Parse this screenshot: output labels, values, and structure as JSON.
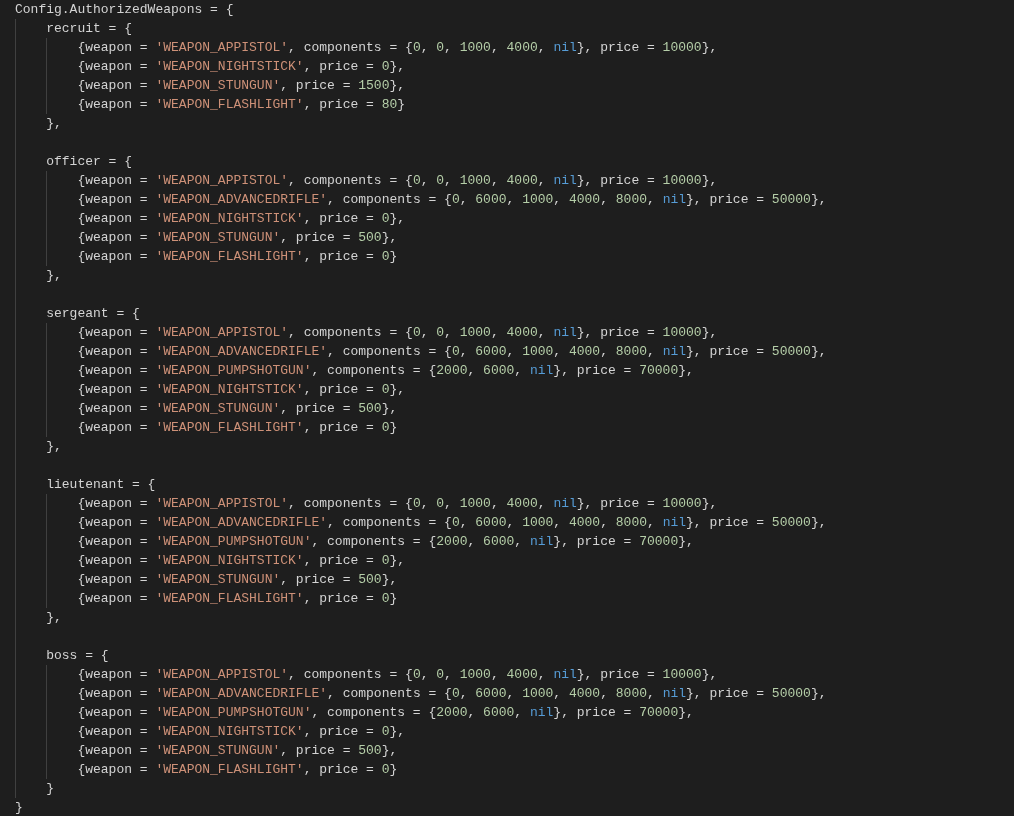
{
  "editor": {
    "code": [
      {
        "kind": "line",
        "tokens": [
          {
            "kind": "plain",
            "text": "Config.AuthorizedWeapons = {"
          }
        ],
        "children": [
          {
            "kind": "line",
            "tokens": [
              {
                "kind": "plain",
                "text": "recruit = {"
              }
            ],
            "children": [
              {
                "kind": "line",
                "tokens": [
                  {
                    "kind": "plain",
                    "text": "{weapon = "
                  },
                  {
                    "kind": "string",
                    "text": "'WEAPON_APPISTOL'"
                  },
                  {
                    "kind": "plain",
                    "text": ", components = {"
                  },
                  {
                    "kind": "number",
                    "text": "0"
                  },
                  {
                    "kind": "plain",
                    "text": ", "
                  },
                  {
                    "kind": "number",
                    "text": "0"
                  },
                  {
                    "kind": "plain",
                    "text": ", "
                  },
                  {
                    "kind": "number",
                    "text": "1000"
                  },
                  {
                    "kind": "plain",
                    "text": ", "
                  },
                  {
                    "kind": "number",
                    "text": "4000"
                  },
                  {
                    "kind": "plain",
                    "text": ", "
                  },
                  {
                    "kind": "keyword",
                    "text": "nil"
                  },
                  {
                    "kind": "plain",
                    "text": "}, price = "
                  },
                  {
                    "kind": "number",
                    "text": "10000"
                  },
                  {
                    "kind": "plain",
                    "text": "},"
                  }
                ]
              },
              {
                "kind": "line",
                "tokens": [
                  {
                    "kind": "plain",
                    "text": "{weapon = "
                  },
                  {
                    "kind": "string",
                    "text": "'WEAPON_NIGHTSTICK'"
                  },
                  {
                    "kind": "plain",
                    "text": ", price = "
                  },
                  {
                    "kind": "number",
                    "text": "0"
                  },
                  {
                    "kind": "plain",
                    "text": "},"
                  }
                ]
              },
              {
                "kind": "line",
                "tokens": [
                  {
                    "kind": "plain",
                    "text": "{weapon = "
                  },
                  {
                    "kind": "string",
                    "text": "'WEAPON_STUNGUN'"
                  },
                  {
                    "kind": "plain",
                    "text": ", price = "
                  },
                  {
                    "kind": "number",
                    "text": "1500"
                  },
                  {
                    "kind": "plain",
                    "text": "},"
                  }
                ]
              },
              {
                "kind": "line",
                "tokens": [
                  {
                    "kind": "plain",
                    "text": "{weapon = "
                  },
                  {
                    "kind": "string",
                    "text": "'WEAPON_FLASHLIGHT'"
                  },
                  {
                    "kind": "plain",
                    "text": ", price = "
                  },
                  {
                    "kind": "number",
                    "text": "80"
                  },
                  {
                    "kind": "plain",
                    "text": "}"
                  }
                ]
              }
            ]
          },
          {
            "kind": "line",
            "tokens": [
              {
                "kind": "plain",
                "text": "},"
              }
            ]
          },
          {
            "kind": "blank"
          },
          {
            "kind": "line",
            "tokens": [
              {
                "kind": "plain",
                "text": "officer = {"
              }
            ],
            "children": [
              {
                "kind": "line",
                "tokens": [
                  {
                    "kind": "plain",
                    "text": "{weapon = "
                  },
                  {
                    "kind": "string",
                    "text": "'WEAPON_APPISTOL'"
                  },
                  {
                    "kind": "plain",
                    "text": ", components = {"
                  },
                  {
                    "kind": "number",
                    "text": "0"
                  },
                  {
                    "kind": "plain",
                    "text": ", "
                  },
                  {
                    "kind": "number",
                    "text": "0"
                  },
                  {
                    "kind": "plain",
                    "text": ", "
                  },
                  {
                    "kind": "number",
                    "text": "1000"
                  },
                  {
                    "kind": "plain",
                    "text": ", "
                  },
                  {
                    "kind": "number",
                    "text": "4000"
                  },
                  {
                    "kind": "plain",
                    "text": ", "
                  },
                  {
                    "kind": "keyword",
                    "text": "nil"
                  },
                  {
                    "kind": "plain",
                    "text": "}, price = "
                  },
                  {
                    "kind": "number",
                    "text": "10000"
                  },
                  {
                    "kind": "plain",
                    "text": "},"
                  }
                ]
              },
              {
                "kind": "line",
                "tokens": [
                  {
                    "kind": "plain",
                    "text": "{weapon = "
                  },
                  {
                    "kind": "string",
                    "text": "'WEAPON_ADVANCEDRIFLE'"
                  },
                  {
                    "kind": "plain",
                    "text": ", components = {"
                  },
                  {
                    "kind": "number",
                    "text": "0"
                  },
                  {
                    "kind": "plain",
                    "text": ", "
                  },
                  {
                    "kind": "number",
                    "text": "6000"
                  },
                  {
                    "kind": "plain",
                    "text": ", "
                  },
                  {
                    "kind": "number",
                    "text": "1000"
                  },
                  {
                    "kind": "plain",
                    "text": ", "
                  },
                  {
                    "kind": "number",
                    "text": "4000"
                  },
                  {
                    "kind": "plain",
                    "text": ", "
                  },
                  {
                    "kind": "number",
                    "text": "8000"
                  },
                  {
                    "kind": "plain",
                    "text": ", "
                  },
                  {
                    "kind": "keyword",
                    "text": "nil"
                  },
                  {
                    "kind": "plain",
                    "text": "}, price = "
                  },
                  {
                    "kind": "number",
                    "text": "50000"
                  },
                  {
                    "kind": "plain",
                    "text": "},"
                  }
                ]
              },
              {
                "kind": "line",
                "tokens": [
                  {
                    "kind": "plain",
                    "text": "{weapon = "
                  },
                  {
                    "kind": "string",
                    "text": "'WEAPON_NIGHTSTICK'"
                  },
                  {
                    "kind": "plain",
                    "text": ", price = "
                  },
                  {
                    "kind": "number",
                    "text": "0"
                  },
                  {
                    "kind": "plain",
                    "text": "},"
                  }
                ]
              },
              {
                "kind": "line",
                "tokens": [
                  {
                    "kind": "plain",
                    "text": "{weapon = "
                  },
                  {
                    "kind": "string",
                    "text": "'WEAPON_STUNGUN'"
                  },
                  {
                    "kind": "plain",
                    "text": ", price = "
                  },
                  {
                    "kind": "number",
                    "text": "500"
                  },
                  {
                    "kind": "plain",
                    "text": "},"
                  }
                ]
              },
              {
                "kind": "line",
                "tokens": [
                  {
                    "kind": "plain",
                    "text": "{weapon = "
                  },
                  {
                    "kind": "string",
                    "text": "'WEAPON_FLASHLIGHT'"
                  },
                  {
                    "kind": "plain",
                    "text": ", price = "
                  },
                  {
                    "kind": "number",
                    "text": "0"
                  },
                  {
                    "kind": "plain",
                    "text": "}"
                  }
                ]
              }
            ]
          },
          {
            "kind": "line",
            "tokens": [
              {
                "kind": "plain",
                "text": "},"
              }
            ]
          },
          {
            "kind": "blank"
          },
          {
            "kind": "line",
            "tokens": [
              {
                "kind": "plain",
                "text": "sergeant = {"
              }
            ],
            "children": [
              {
                "kind": "line",
                "tokens": [
                  {
                    "kind": "plain",
                    "text": "{weapon = "
                  },
                  {
                    "kind": "string",
                    "text": "'WEAPON_APPISTOL'"
                  },
                  {
                    "kind": "plain",
                    "text": ", components = {"
                  },
                  {
                    "kind": "number",
                    "text": "0"
                  },
                  {
                    "kind": "plain",
                    "text": ", "
                  },
                  {
                    "kind": "number",
                    "text": "0"
                  },
                  {
                    "kind": "plain",
                    "text": ", "
                  },
                  {
                    "kind": "number",
                    "text": "1000"
                  },
                  {
                    "kind": "plain",
                    "text": ", "
                  },
                  {
                    "kind": "number",
                    "text": "4000"
                  },
                  {
                    "kind": "plain",
                    "text": ", "
                  },
                  {
                    "kind": "keyword",
                    "text": "nil"
                  },
                  {
                    "kind": "plain",
                    "text": "}, price = "
                  },
                  {
                    "kind": "number",
                    "text": "10000"
                  },
                  {
                    "kind": "plain",
                    "text": "},"
                  }
                ]
              },
              {
                "kind": "line",
                "tokens": [
                  {
                    "kind": "plain",
                    "text": "{weapon = "
                  },
                  {
                    "kind": "string",
                    "text": "'WEAPON_ADVANCEDRIFLE'"
                  },
                  {
                    "kind": "plain",
                    "text": ", components = {"
                  },
                  {
                    "kind": "number",
                    "text": "0"
                  },
                  {
                    "kind": "plain",
                    "text": ", "
                  },
                  {
                    "kind": "number",
                    "text": "6000"
                  },
                  {
                    "kind": "plain",
                    "text": ", "
                  },
                  {
                    "kind": "number",
                    "text": "1000"
                  },
                  {
                    "kind": "plain",
                    "text": ", "
                  },
                  {
                    "kind": "number",
                    "text": "4000"
                  },
                  {
                    "kind": "plain",
                    "text": ", "
                  },
                  {
                    "kind": "number",
                    "text": "8000"
                  },
                  {
                    "kind": "plain",
                    "text": ", "
                  },
                  {
                    "kind": "keyword",
                    "text": "nil"
                  },
                  {
                    "kind": "plain",
                    "text": "}, price = "
                  },
                  {
                    "kind": "number",
                    "text": "50000"
                  },
                  {
                    "kind": "plain",
                    "text": "},"
                  }
                ]
              },
              {
                "kind": "line",
                "tokens": [
                  {
                    "kind": "plain",
                    "text": "{weapon = "
                  },
                  {
                    "kind": "string",
                    "text": "'WEAPON_PUMPSHOTGUN'"
                  },
                  {
                    "kind": "plain",
                    "text": ", components = {"
                  },
                  {
                    "kind": "number",
                    "text": "2000"
                  },
                  {
                    "kind": "plain",
                    "text": ", "
                  },
                  {
                    "kind": "number",
                    "text": "6000"
                  },
                  {
                    "kind": "plain",
                    "text": ", "
                  },
                  {
                    "kind": "keyword",
                    "text": "nil"
                  },
                  {
                    "kind": "plain",
                    "text": "}, price = "
                  },
                  {
                    "kind": "number",
                    "text": "70000"
                  },
                  {
                    "kind": "plain",
                    "text": "},"
                  }
                ]
              },
              {
                "kind": "line",
                "tokens": [
                  {
                    "kind": "plain",
                    "text": "{weapon = "
                  },
                  {
                    "kind": "string",
                    "text": "'WEAPON_NIGHTSTICK'"
                  },
                  {
                    "kind": "plain",
                    "text": ", price = "
                  },
                  {
                    "kind": "number",
                    "text": "0"
                  },
                  {
                    "kind": "plain",
                    "text": "},"
                  }
                ]
              },
              {
                "kind": "line",
                "tokens": [
                  {
                    "kind": "plain",
                    "text": "{weapon = "
                  },
                  {
                    "kind": "string",
                    "text": "'WEAPON_STUNGUN'"
                  },
                  {
                    "kind": "plain",
                    "text": ", price = "
                  },
                  {
                    "kind": "number",
                    "text": "500"
                  },
                  {
                    "kind": "plain",
                    "text": "},"
                  }
                ]
              },
              {
                "kind": "line",
                "tokens": [
                  {
                    "kind": "plain",
                    "text": "{weapon = "
                  },
                  {
                    "kind": "string",
                    "text": "'WEAPON_FLASHLIGHT'"
                  },
                  {
                    "kind": "plain",
                    "text": ", price = "
                  },
                  {
                    "kind": "number",
                    "text": "0"
                  },
                  {
                    "kind": "plain",
                    "text": "}"
                  }
                ]
              }
            ]
          },
          {
            "kind": "line",
            "tokens": [
              {
                "kind": "plain",
                "text": "},"
              }
            ]
          },
          {
            "kind": "blank"
          },
          {
            "kind": "line",
            "tokens": [
              {
                "kind": "plain",
                "text": "lieutenant = {"
              }
            ],
            "children": [
              {
                "kind": "line",
                "tokens": [
                  {
                    "kind": "plain",
                    "text": "{weapon = "
                  },
                  {
                    "kind": "string",
                    "text": "'WEAPON_APPISTOL'"
                  },
                  {
                    "kind": "plain",
                    "text": ", components = {"
                  },
                  {
                    "kind": "number",
                    "text": "0"
                  },
                  {
                    "kind": "plain",
                    "text": ", "
                  },
                  {
                    "kind": "number",
                    "text": "0"
                  },
                  {
                    "kind": "plain",
                    "text": ", "
                  },
                  {
                    "kind": "number",
                    "text": "1000"
                  },
                  {
                    "kind": "plain",
                    "text": ", "
                  },
                  {
                    "kind": "number",
                    "text": "4000"
                  },
                  {
                    "kind": "plain",
                    "text": ", "
                  },
                  {
                    "kind": "keyword",
                    "text": "nil"
                  },
                  {
                    "kind": "plain",
                    "text": "}, price = "
                  },
                  {
                    "kind": "number",
                    "text": "10000"
                  },
                  {
                    "kind": "plain",
                    "text": "},"
                  }
                ]
              },
              {
                "kind": "line",
                "tokens": [
                  {
                    "kind": "plain",
                    "text": "{weapon = "
                  },
                  {
                    "kind": "string",
                    "text": "'WEAPON_ADVANCEDRIFLE'"
                  },
                  {
                    "kind": "plain",
                    "text": ", components = {"
                  },
                  {
                    "kind": "number",
                    "text": "0"
                  },
                  {
                    "kind": "plain",
                    "text": ", "
                  },
                  {
                    "kind": "number",
                    "text": "6000"
                  },
                  {
                    "kind": "plain",
                    "text": ", "
                  },
                  {
                    "kind": "number",
                    "text": "1000"
                  },
                  {
                    "kind": "plain",
                    "text": ", "
                  },
                  {
                    "kind": "number",
                    "text": "4000"
                  },
                  {
                    "kind": "plain",
                    "text": ", "
                  },
                  {
                    "kind": "number",
                    "text": "8000"
                  },
                  {
                    "kind": "plain",
                    "text": ", "
                  },
                  {
                    "kind": "keyword",
                    "text": "nil"
                  },
                  {
                    "kind": "plain",
                    "text": "}, price = "
                  },
                  {
                    "kind": "number",
                    "text": "50000"
                  },
                  {
                    "kind": "plain",
                    "text": "},"
                  }
                ]
              },
              {
                "kind": "line",
                "tokens": [
                  {
                    "kind": "plain",
                    "text": "{weapon = "
                  },
                  {
                    "kind": "string",
                    "text": "'WEAPON_PUMPSHOTGUN'"
                  },
                  {
                    "kind": "plain",
                    "text": ", components = {"
                  },
                  {
                    "kind": "number",
                    "text": "2000"
                  },
                  {
                    "kind": "plain",
                    "text": ", "
                  },
                  {
                    "kind": "number",
                    "text": "6000"
                  },
                  {
                    "kind": "plain",
                    "text": ", "
                  },
                  {
                    "kind": "keyword",
                    "text": "nil"
                  },
                  {
                    "kind": "plain",
                    "text": "}, price = "
                  },
                  {
                    "kind": "number",
                    "text": "70000"
                  },
                  {
                    "kind": "plain",
                    "text": "},"
                  }
                ]
              },
              {
                "kind": "line",
                "tokens": [
                  {
                    "kind": "plain",
                    "text": "{weapon = "
                  },
                  {
                    "kind": "string",
                    "text": "'WEAPON_NIGHTSTICK'"
                  },
                  {
                    "kind": "plain",
                    "text": ", price = "
                  },
                  {
                    "kind": "number",
                    "text": "0"
                  },
                  {
                    "kind": "plain",
                    "text": "},"
                  }
                ]
              },
              {
                "kind": "line",
                "tokens": [
                  {
                    "kind": "plain",
                    "text": "{weapon = "
                  },
                  {
                    "kind": "string",
                    "text": "'WEAPON_STUNGUN'"
                  },
                  {
                    "kind": "plain",
                    "text": ", price = "
                  },
                  {
                    "kind": "number",
                    "text": "500"
                  },
                  {
                    "kind": "plain",
                    "text": "},"
                  }
                ]
              },
              {
                "kind": "line",
                "tokens": [
                  {
                    "kind": "plain",
                    "text": "{weapon = "
                  },
                  {
                    "kind": "string",
                    "text": "'WEAPON_FLASHLIGHT'"
                  },
                  {
                    "kind": "plain",
                    "text": ", price = "
                  },
                  {
                    "kind": "number",
                    "text": "0"
                  },
                  {
                    "kind": "plain",
                    "text": "}"
                  }
                ]
              }
            ]
          },
          {
            "kind": "line",
            "tokens": [
              {
                "kind": "plain",
                "text": "},"
              }
            ]
          },
          {
            "kind": "blank"
          },
          {
            "kind": "line",
            "tokens": [
              {
                "kind": "plain",
                "text": "boss = {"
              }
            ],
            "children": [
              {
                "kind": "line",
                "tokens": [
                  {
                    "kind": "plain",
                    "text": "{weapon = "
                  },
                  {
                    "kind": "string",
                    "text": "'WEAPON_APPISTOL'"
                  },
                  {
                    "kind": "plain",
                    "text": ", components = {"
                  },
                  {
                    "kind": "number",
                    "text": "0"
                  },
                  {
                    "kind": "plain",
                    "text": ", "
                  },
                  {
                    "kind": "number",
                    "text": "0"
                  },
                  {
                    "kind": "plain",
                    "text": ", "
                  },
                  {
                    "kind": "number",
                    "text": "1000"
                  },
                  {
                    "kind": "plain",
                    "text": ", "
                  },
                  {
                    "kind": "number",
                    "text": "4000"
                  },
                  {
                    "kind": "plain",
                    "text": ", "
                  },
                  {
                    "kind": "keyword",
                    "text": "nil"
                  },
                  {
                    "kind": "plain",
                    "text": "}, price = "
                  },
                  {
                    "kind": "number",
                    "text": "10000"
                  },
                  {
                    "kind": "plain",
                    "text": "},"
                  }
                ]
              },
              {
                "kind": "line",
                "tokens": [
                  {
                    "kind": "plain",
                    "text": "{weapon = "
                  },
                  {
                    "kind": "string",
                    "text": "'WEAPON_ADVANCEDRIFLE'"
                  },
                  {
                    "kind": "plain",
                    "text": ", components = {"
                  },
                  {
                    "kind": "number",
                    "text": "0"
                  },
                  {
                    "kind": "plain",
                    "text": ", "
                  },
                  {
                    "kind": "number",
                    "text": "6000"
                  },
                  {
                    "kind": "plain",
                    "text": ", "
                  },
                  {
                    "kind": "number",
                    "text": "1000"
                  },
                  {
                    "kind": "plain",
                    "text": ", "
                  },
                  {
                    "kind": "number",
                    "text": "4000"
                  },
                  {
                    "kind": "plain",
                    "text": ", "
                  },
                  {
                    "kind": "number",
                    "text": "8000"
                  },
                  {
                    "kind": "plain",
                    "text": ", "
                  },
                  {
                    "kind": "keyword",
                    "text": "nil"
                  },
                  {
                    "kind": "plain",
                    "text": "}, price = "
                  },
                  {
                    "kind": "number",
                    "text": "50000"
                  },
                  {
                    "kind": "plain",
                    "text": "},"
                  }
                ]
              },
              {
                "kind": "line",
                "tokens": [
                  {
                    "kind": "plain",
                    "text": "{weapon = "
                  },
                  {
                    "kind": "string",
                    "text": "'WEAPON_PUMPSHOTGUN'"
                  },
                  {
                    "kind": "plain",
                    "text": ", components = {"
                  },
                  {
                    "kind": "number",
                    "text": "2000"
                  },
                  {
                    "kind": "plain",
                    "text": ", "
                  },
                  {
                    "kind": "number",
                    "text": "6000"
                  },
                  {
                    "kind": "plain",
                    "text": ", "
                  },
                  {
                    "kind": "keyword",
                    "text": "nil"
                  },
                  {
                    "kind": "plain",
                    "text": "}, price = "
                  },
                  {
                    "kind": "number",
                    "text": "70000"
                  },
                  {
                    "kind": "plain",
                    "text": "},"
                  }
                ]
              },
              {
                "kind": "line",
                "tokens": [
                  {
                    "kind": "plain",
                    "text": "{weapon = "
                  },
                  {
                    "kind": "string",
                    "text": "'WEAPON_NIGHTSTICK'"
                  },
                  {
                    "kind": "plain",
                    "text": ", price = "
                  },
                  {
                    "kind": "number",
                    "text": "0"
                  },
                  {
                    "kind": "plain",
                    "text": "},"
                  }
                ]
              },
              {
                "kind": "line",
                "tokens": [
                  {
                    "kind": "plain",
                    "text": "{weapon = "
                  },
                  {
                    "kind": "string",
                    "text": "'WEAPON_STUNGUN'"
                  },
                  {
                    "kind": "plain",
                    "text": ", price = "
                  },
                  {
                    "kind": "number",
                    "text": "500"
                  },
                  {
                    "kind": "plain",
                    "text": "},"
                  }
                ]
              },
              {
                "kind": "line",
                "tokens": [
                  {
                    "kind": "plain",
                    "text": "{weapon = "
                  },
                  {
                    "kind": "string",
                    "text": "'WEAPON_FLASHLIGHT'"
                  },
                  {
                    "kind": "plain",
                    "text": ", price = "
                  },
                  {
                    "kind": "number",
                    "text": "0"
                  },
                  {
                    "kind": "plain",
                    "text": "}"
                  }
                ]
              }
            ]
          },
          {
            "kind": "line",
            "tokens": [
              {
                "kind": "plain",
                "text": "}"
              }
            ]
          }
        ]
      },
      {
        "kind": "line",
        "tokens": [
          {
            "kind": "plain",
            "text": "}"
          }
        ]
      }
    ]
  }
}
